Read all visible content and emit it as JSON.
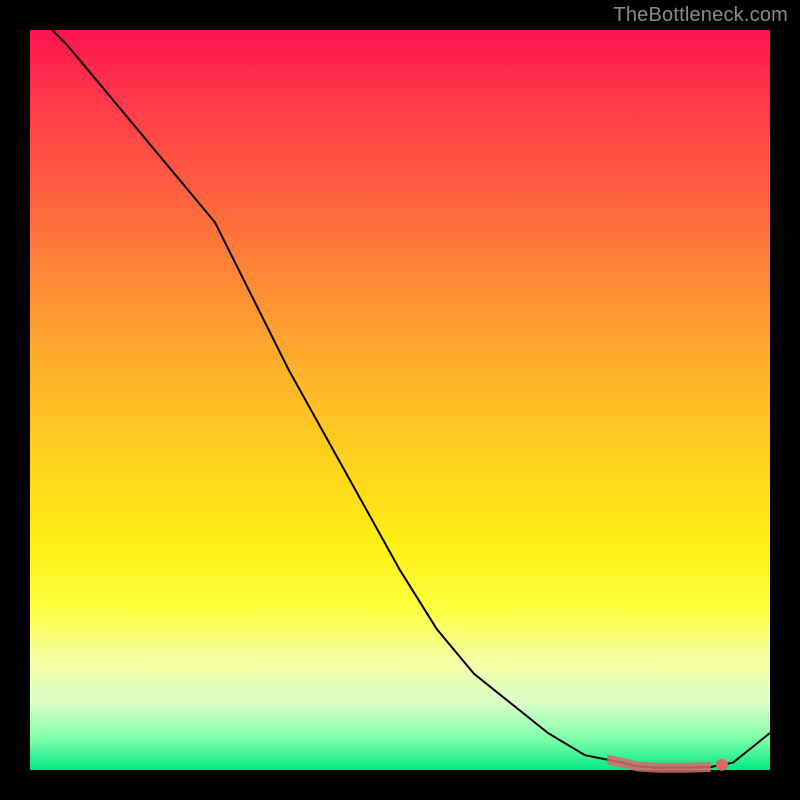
{
  "watermark": "TheBottleneck.com",
  "chart_data": {
    "type": "line",
    "title": "",
    "xlabel": "",
    "ylabel": "",
    "x": [
      0,
      5,
      10,
      15,
      20,
      25,
      30,
      35,
      40,
      45,
      50,
      55,
      60,
      65,
      70,
      75,
      80,
      82,
      85,
      88,
      92,
      95,
      100
    ],
    "values": [
      103,
      98,
      92,
      86,
      80,
      74,
      64,
      54,
      45,
      36,
      27,
      19,
      13,
      9,
      5,
      2,
      1,
      0.5,
      0.3,
      0.3,
      0.4,
      1,
      5
    ],
    "xlim": [
      0,
      100
    ],
    "ylim": [
      0,
      100
    ],
    "band_x_range": [
      78,
      92
    ],
    "marker_x": 93.5,
    "gradient_stops": [
      {
        "pos": 0.0,
        "color": "#ff1450"
      },
      {
        "pos": 0.5,
        "color": "#ffd21e"
      },
      {
        "pos": 0.8,
        "color": "#ffff40"
      },
      {
        "pos": 1.0,
        "color": "#00e884"
      }
    ]
  }
}
